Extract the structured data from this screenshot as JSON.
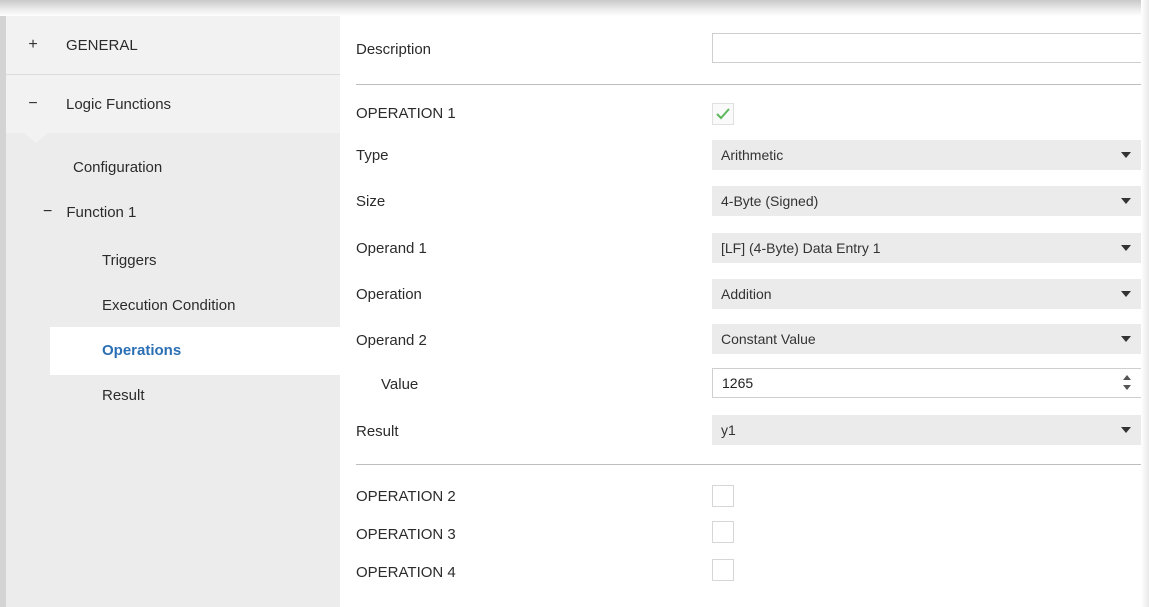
{
  "sidebar": {
    "general": {
      "symbol": "+",
      "label": "GENERAL"
    },
    "logic_functions": {
      "symbol": "−",
      "label": "Logic Functions"
    },
    "configuration": "Configuration",
    "function1": {
      "symbol": "−",
      "label": "Function 1"
    },
    "triggers": "Triggers",
    "execution_condition": "Execution Condition",
    "operations": "Operations",
    "result": "Result"
  },
  "form": {
    "description_label": "Description",
    "description_value": "",
    "operation1_label": "OPERATION 1",
    "operation1_checked": true,
    "type_label": "Type",
    "type_value": "Arithmetic",
    "size_label": "Size",
    "size_value": "4-Byte (Signed)",
    "operand1_label": "Operand 1",
    "operand1_value": "[LF] (4-Byte) Data Entry 1",
    "operation_label": "Operation",
    "operation_value": "Addition",
    "operand2_label": "Operand 2",
    "operand2_value": "Constant Value",
    "value_label": "Value",
    "value_value": "1265",
    "result_label": "Result",
    "result_value": "y1",
    "operation2_label": "OPERATION 2",
    "operation2_checked": false,
    "operation3_label": "OPERATION 3",
    "operation3_checked": false,
    "operation4_label": "OPERATION 4",
    "operation4_checked": false
  },
  "colors": {
    "selected_text": "#2b6fb5",
    "checkmark": "#5cb85c",
    "sidebar_bg": "#ececec"
  }
}
